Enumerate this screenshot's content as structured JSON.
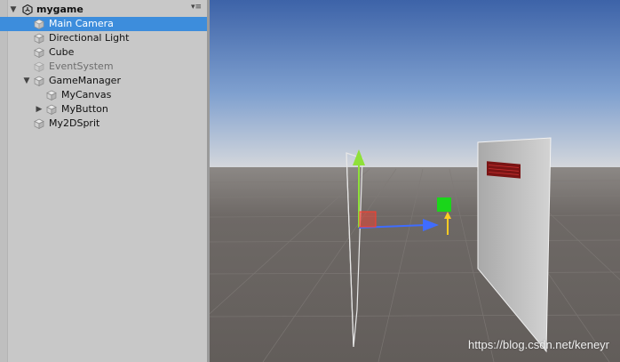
{
  "hierarchy": {
    "scene_name": "mygame",
    "items": [
      {
        "label": "Main Camera",
        "selected": true,
        "disabled": false
      },
      {
        "label": "Directional Light",
        "selected": false,
        "disabled": false
      },
      {
        "label": "Cube",
        "selected": false,
        "disabled": false
      },
      {
        "label": "EventSystem",
        "selected": false,
        "disabled": true
      },
      {
        "label": "GameManager",
        "selected": false,
        "disabled": false,
        "expanded": true
      },
      {
        "label": "MyCanvas",
        "selected": false,
        "disabled": false
      },
      {
        "label": "MyButton",
        "selected": false,
        "disabled": false,
        "collapsed": true
      },
      {
        "label": "My2DSprit",
        "selected": false,
        "disabled": false
      }
    ]
  },
  "scene": {
    "watermark": "https://blog.csdn.net/keneyr",
    "sky_color": "#5f86c4",
    "ground_color": "#6a6562",
    "gizmo_colors": {
      "x_axis": "#3f6cff",
      "y_axis": "#8fe03a",
      "z_axis": "#ff3b2b",
      "center": "#1ad61a"
    }
  },
  "icons": {
    "scene": "unity-logo-icon",
    "objects": "gameobject-cube-icon",
    "menu": "panel-menu-icon"
  }
}
